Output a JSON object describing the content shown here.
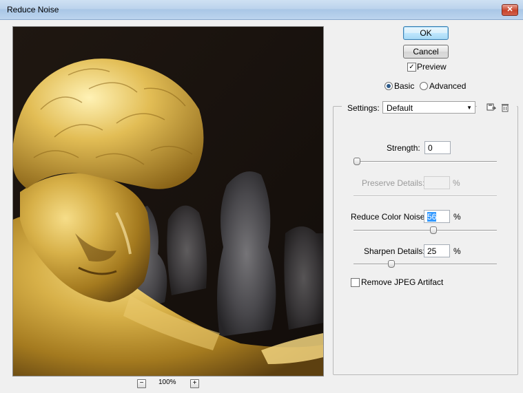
{
  "window": {
    "title": "Reduce Noise",
    "close_glyph": "✕"
  },
  "buttons": {
    "ok": "OK",
    "cancel": "Cancel"
  },
  "preview_toggle": {
    "label": "Preview",
    "checked": true
  },
  "mode": {
    "basic": "Basic",
    "advanced": "Advanced",
    "selected": "basic"
  },
  "settings": {
    "label": "Settings:",
    "value": "Default",
    "icons": [
      "save-settings-icon",
      "delete-settings-icon"
    ]
  },
  "strength": {
    "label": "Strength:",
    "value": "0",
    "level": 0
  },
  "preserve_details": {
    "label": "Preserve Details:",
    "value": "",
    "unit": "%",
    "enabled": false,
    "level": 0.0
  },
  "reduce_color_noise": {
    "label": "Reduce Color Noise:",
    "value": "56",
    "unit": "%",
    "level": 0.56
  },
  "sharpen_details": {
    "label": "Sharpen Details:",
    "value": "25",
    "unit": "%",
    "level": 0.25
  },
  "jpeg_artifact": {
    "label": "Remove JPEG Artifact",
    "checked": false
  },
  "zoom": {
    "level": "100%",
    "minus": "−",
    "plus": "+"
  },
  "colors": {
    "accent": "#3399ff",
    "gold": "#c9a23a"
  }
}
